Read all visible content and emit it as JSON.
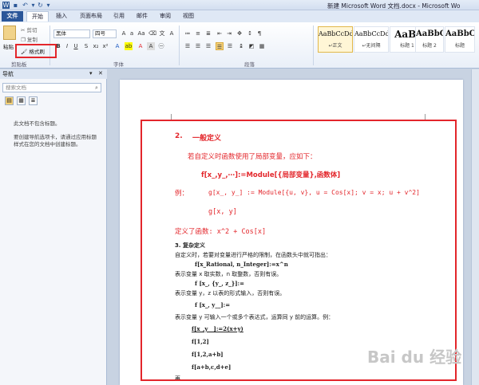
{
  "titlebar": {
    "title": "新建 Microsoft Word 文档.docx - Microsoft Wo"
  },
  "tabs": [
    "文件",
    "开始",
    "插入",
    "页面布局",
    "引用",
    "邮件",
    "审阅",
    "视图"
  ],
  "clipboard": {
    "paste": "粘贴",
    "cut": "剪切",
    "copy": "复制",
    "format_painter": "格式刷",
    "label": "剪贴板"
  },
  "font": {
    "name": "黑体",
    "size": "四号",
    "label": "字体"
  },
  "paragraph": {
    "label": "段落"
  },
  "styles": [
    {
      "preview": "AaBbCcDd",
      "name": "↵正文"
    },
    {
      "preview": "AaBbCcDd",
      "name": "↵无间隔"
    },
    {
      "preview": "AaBl",
      "name": "标题 1"
    },
    {
      "preview": "AaBbC",
      "name": "标题 2"
    },
    {
      "preview": "AaBbC",
      "name": "标题"
    }
  ],
  "nav": {
    "title": "导航",
    "search_placeholder": "搜索文档",
    "msg1": "此文档不包含标题。",
    "msg2": "要创建导航选项卡，请通过应用标题样式在您的文档中创建标题。"
  },
  "doc": {
    "l1_num": "2.",
    "l1_text": "一般定义",
    "l2": "若自定义时函数使用了局部变量，应如下：",
    "l3": "f[x_,y_,⋯]:=Module[{局部变量},函数体]",
    "l4_label": "例：",
    "l4": "g[x_, y_] := Module[{u, v}, u = Cos[x]; v = x; u + v^2]",
    "l5": "g[x, y]",
    "l6": "定义了函数: x^2 + Cos[x]",
    "l7": "3. 复杂定义",
    "l8": "自定义时，若要对变量进行严格的限制，在函数头中就可指出：",
    "l9": "f[x_Rational, n_Integer]:=x^n",
    "l10": "表示变量 x 取实数，n 取整数，否则有误。",
    "l11": "f [x_, {y_, z_}]:=",
    "l12": "表示变量 y，z 以表的形式输入，否则有误。",
    "l13": "f [x_, y__]:=",
    "l14": "表示变量 y 可输入一个或多个表达式，运算同 y 前的运算。例：",
    "l15": "f[x_,y__]:=2(x+y)",
    "l16": "f[1,2]",
    "l17": "f[1,2,a+b]",
    "l18": "f[a+b,c,d+e]",
    "l19": "再"
  },
  "watermark": "Bai du 经验"
}
